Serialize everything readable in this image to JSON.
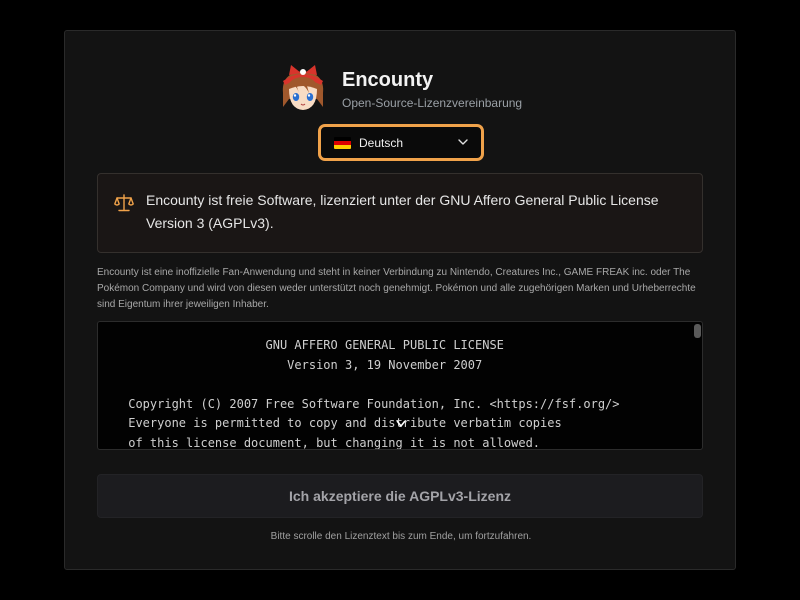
{
  "app": {
    "title": "Encounty",
    "subtitle": "Open-Source-Lizenzvereinbarung",
    "avatar_icon": "trainer-avatar"
  },
  "language_select": {
    "selected": "Deutsch",
    "flag_icon": "german-flag-icon",
    "flag_colors": [
      "#000000",
      "#dd0000",
      "#ffce00"
    ],
    "accent_border": "#f0a24a"
  },
  "notice": {
    "icon": "scale-icon",
    "text": "Encounty ist freie Software, lizenziert unter der GNU Affero General Public License Version 3 (AGPLv3)."
  },
  "disclaimer": "Encounty ist eine inoffizielle Fan-Anwendung und steht in keiner Verbindung zu Nintendo, Creatures Inc., GAME FREAK inc. oder The Pokémon Company und wird von diesen weder unterstützt noch genehmigt. Pokémon und alle zugehörigen Marken und Urheberrechte sind Eigentum ihrer jeweiligen Inhaber.",
  "license": {
    "lines": [
      "                    GNU AFFERO GENERAL PUBLIC LICENSE",
      "                       Version 3, 19 November 2007",
      "",
      " Copyright (C) 2007 Free Software Foundation, Inc. <https://fsf.org/>",
      " Everyone is permitted to copy and distribute verbatim copies",
      " of this license document, but changing it is not allowed."
    ]
  },
  "accept_button": {
    "label": "Ich akzeptiere die AGPLv3-Lizenz",
    "enabled": false
  },
  "hint": "Bitte scrolle den Lizenztext bis zum Ende, um fortzufahren."
}
